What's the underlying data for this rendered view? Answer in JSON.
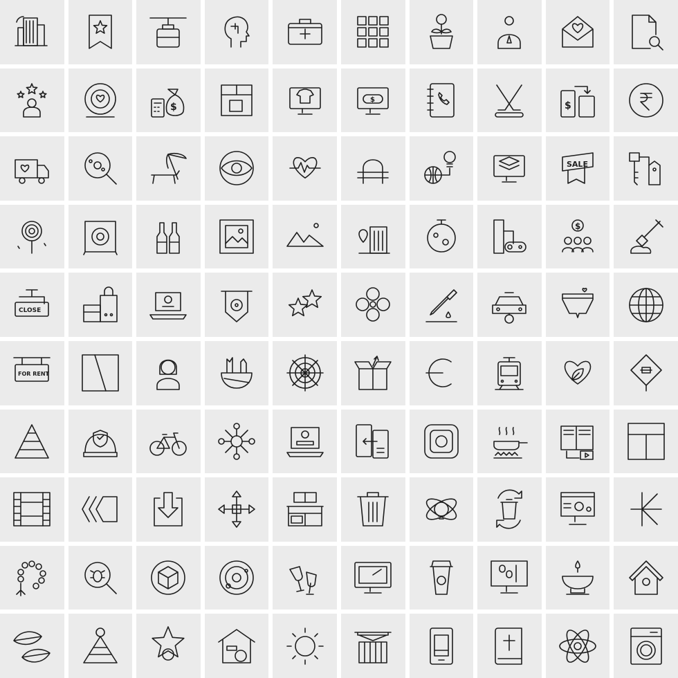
{
  "icons": [
    {
      "name": "smart-building"
    },
    {
      "name": "bookmark-star"
    },
    {
      "name": "cable-car"
    },
    {
      "name": "mind-head"
    },
    {
      "name": "first-aid-kit"
    },
    {
      "name": "app-grid"
    },
    {
      "name": "money-plant"
    },
    {
      "name": "user-settings"
    },
    {
      "name": "love-letter"
    },
    {
      "name": "file-search"
    },
    {
      "name": "star-employee"
    },
    {
      "name": "heart-coin"
    },
    {
      "name": "money-bag-calculator"
    },
    {
      "name": "layout-design"
    },
    {
      "name": "tshirt-monitor"
    },
    {
      "name": "online-payment-monitor"
    },
    {
      "name": "phone-book"
    },
    {
      "name": "hockey"
    },
    {
      "name": "mobile-card-transfer"
    },
    {
      "name": "rupee-coin"
    },
    {
      "name": "love-truck"
    },
    {
      "name": "virus-magnifier"
    },
    {
      "name": "beach-chair"
    },
    {
      "name": "eye"
    },
    {
      "name": "heart-pulse"
    },
    {
      "name": "austral-sign"
    },
    {
      "name": "global-idea"
    },
    {
      "name": "layers-monitor"
    },
    {
      "name": "sale-banner",
      "label": "SALE"
    },
    {
      "name": "key-tag"
    },
    {
      "name": "lollipop"
    },
    {
      "name": "speaker-box"
    },
    {
      "name": "bottles"
    },
    {
      "name": "image-frame"
    },
    {
      "name": "mountains"
    },
    {
      "name": "city-location"
    },
    {
      "name": "moon-planet"
    },
    {
      "name": "game-controller-machine"
    },
    {
      "name": "business-meeting"
    },
    {
      "name": "shovel"
    },
    {
      "name": "close-sign",
      "label": "CLOSE"
    },
    {
      "name": "shopping-bags"
    },
    {
      "name": "laptop-user"
    },
    {
      "name": "radioactive-banner"
    },
    {
      "name": "fireworks"
    },
    {
      "name": "clover"
    },
    {
      "name": "dropper"
    },
    {
      "name": "car"
    },
    {
      "name": "underwear"
    },
    {
      "name": "globe"
    },
    {
      "name": "for-rent-sign",
      "label": "FOR RENT"
    },
    {
      "name": "square-diagonal"
    },
    {
      "name": "woman-avatar"
    },
    {
      "name": "broken-bowl"
    },
    {
      "name": "spider-web"
    },
    {
      "name": "open-box"
    },
    {
      "name": "euro-sign"
    },
    {
      "name": "tram"
    },
    {
      "name": "heart-leaf"
    },
    {
      "name": "road-sign"
    },
    {
      "name": "pyramid"
    },
    {
      "name": "helmet-shield"
    },
    {
      "name": "bicycle"
    },
    {
      "name": "team-network"
    },
    {
      "name": "laptop-login"
    },
    {
      "name": "mobile-transfer"
    },
    {
      "name": "instagram"
    },
    {
      "name": "cooking-pan"
    },
    {
      "name": "book-video"
    },
    {
      "name": "layout-window"
    },
    {
      "name": "film-strip"
    },
    {
      "name": "back-arrows"
    },
    {
      "name": "download-box"
    },
    {
      "name": "move-arrows"
    },
    {
      "name": "kitchen-cabinet"
    },
    {
      "name": "trash-bin"
    },
    {
      "name": "bulb-orbit"
    },
    {
      "name": "recycle-bin"
    },
    {
      "name": "monitor-settings"
    },
    {
      "name": "kip-sign"
    },
    {
      "name": "rosary"
    },
    {
      "name": "bug-search"
    },
    {
      "name": "3d-cube"
    },
    {
      "name": "solar-system"
    },
    {
      "name": "wine-toast"
    },
    {
      "name": "monitor"
    },
    {
      "name": "coffee-cup"
    },
    {
      "name": "monitor-document"
    },
    {
      "name": "oil-lamp"
    },
    {
      "name": "birdhouse"
    },
    {
      "name": "leaves"
    },
    {
      "name": "pyramid-user"
    },
    {
      "name": "star-coin"
    },
    {
      "name": "house-gear"
    },
    {
      "name": "sun"
    },
    {
      "name": "container"
    },
    {
      "name": "mobile-card"
    },
    {
      "name": "bible"
    },
    {
      "name": "atom"
    },
    {
      "name": "washing-machine"
    }
  ],
  "colors": {
    "cell_background": "#ebebeb",
    "gap": "#ffffff",
    "stroke": "#1e1e1e"
  }
}
